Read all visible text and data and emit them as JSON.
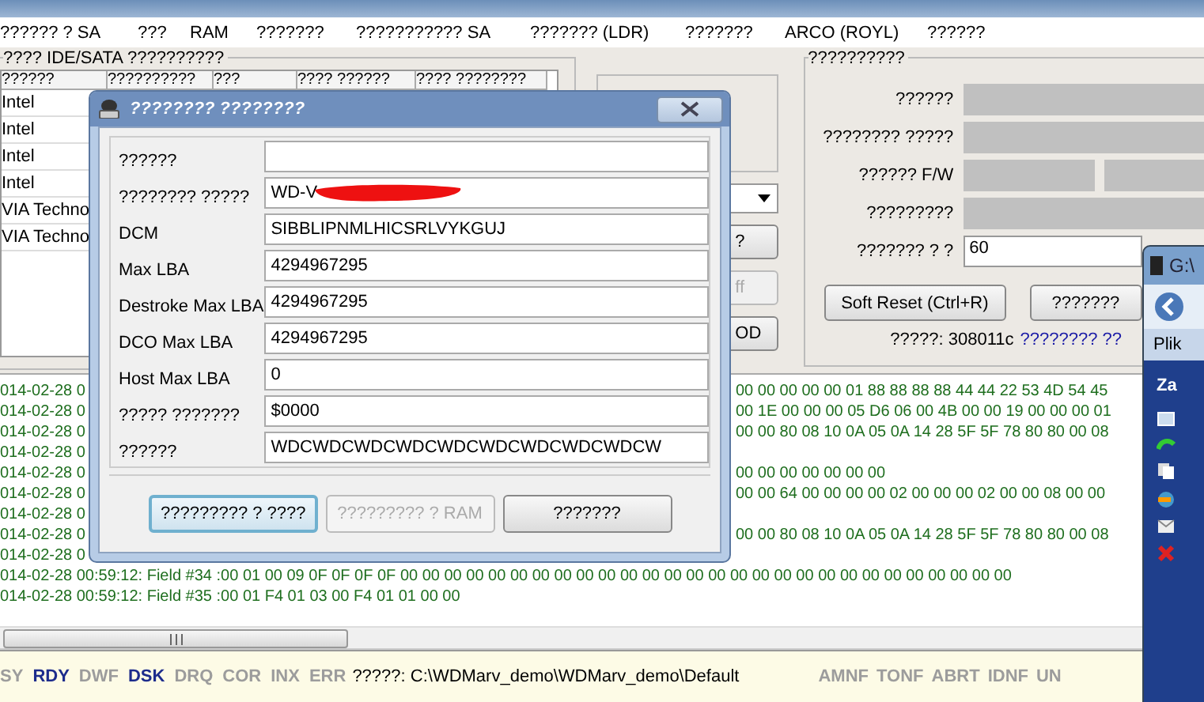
{
  "menu": [
    {
      "label": "?????? ? SA"
    },
    {
      "label": "???"
    },
    {
      "label": "RAM"
    },
    {
      "label": "???????"
    },
    {
      "label": "??????????? SA"
    },
    {
      "label": "??????? (LDR)"
    },
    {
      "label": "???????"
    },
    {
      "label": "ARCO (ROYL)"
    },
    {
      "label": "??????"
    }
  ],
  "drive_group": {
    "title": "???? IDE/SATA ??????????",
    "columns": [
      "??????",
      "??????????",
      "???",
      "???? ??????",
      "???? ????????"
    ],
    "rows": [
      "Intel",
      "Intel",
      "Intel",
      "Intel",
      "VIA Techno",
      "VIA Techno"
    ]
  },
  "middle": {
    "buttons": [
      {
        "label": "?",
        "disabled": false
      },
      {
        "label": "ff",
        "disabled": true
      },
      {
        "label": "OD",
        "disabled": false
      }
    ]
  },
  "info_group": {
    "title": "??????????",
    "rows": [
      {
        "label": "??????",
        "kind": "single"
      },
      {
        "label": "???????? ?????",
        "kind": "single"
      },
      {
        "label": "?????? F/W",
        "kind": "double"
      },
      {
        "label": "?????????",
        "kind": "single"
      },
      {
        "label": "??????? ? ?",
        "kind": "input",
        "value": "60"
      }
    ],
    "buttons": [
      "Soft Reset (Ctrl+R)",
      "???????"
    ],
    "footer": "?????: 308011c",
    "footer_link": "???????? ??"
  },
  "log": [
    {
      "kind": "split",
      "left": "014-02-28 0",
      "right": "00 00 00 00 00 01 88 88 88 88 44 44 22 53 4D 54 45"
    },
    {
      "kind": "split",
      "left": "014-02-28 0",
      "right": "00 1E 00 00 00 05 D6 06 00 4B 00 00 19 00 00 00 01"
    },
    {
      "kind": "split",
      "left": "014-02-28 0",
      "right": "00 00 80 08 10 0A 05 0A 14 28 5F 5F 78 80 80 00 08"
    },
    {
      "kind": "split",
      "left": "014-02-28 0"
    },
    {
      "kind": "split",
      "left": "014-02-28 0",
      "right": " 00 00 00 00 00 00 00"
    },
    {
      "kind": "split",
      "left": "014-02-28 0",
      "right": "00 00 64 00 00 00 00 02 00 00 00 02 00 00 08 00 00"
    },
    {
      "kind": "split",
      "left": "014-02-28 0"
    },
    {
      "kind": "split",
      "left": "014-02-28 0",
      "right": "00 00 80 08 10 0A 05 0A 14 28 5F 5F 78 80 80 00 08"
    },
    {
      "kind": "split",
      "left": "014-02-28 0"
    },
    {
      "kind": "full",
      "text": "014-02-28 00:59:12: Field #34 :00 01 00 09 0F 0F 0F 0F 00 00 00 00 00 00 00 00 00 00 00 00 00 00 00 00 00 00 00 00 00 00 00 00 00 00 00 00"
    },
    {
      "kind": "full",
      "text": "014-02-28 00:59:12: Field #35 :00 01 F4 01 03 00 F4 01 01 00 00"
    }
  ],
  "status_bar": {
    "flags": [
      {
        "label": "SY",
        "on": false
      },
      {
        "label": "RDY",
        "on": true
      },
      {
        "label": "DWF",
        "on": false
      },
      {
        "label": "DSK",
        "on": true
      },
      {
        "label": "DRQ",
        "on": false
      },
      {
        "label": "COR",
        "on": false
      },
      {
        "label": "INX",
        "on": false
      },
      {
        "label": "ERR",
        "on": false
      }
    ],
    "path": "?????: C:\\WDMarv_demo\\WDMarv_demo\\Default",
    "error_flags": [
      {
        "label": "AMNF",
        "on": false
      },
      {
        "label": "TONF",
        "on": false
      },
      {
        "label": "ABRT",
        "on": false
      },
      {
        "label": "IDNF",
        "on": false
      },
      {
        "label": "UN",
        "on": false
      }
    ]
  },
  "dialog": {
    "title": "???????? ????????",
    "fields": [
      {
        "label": "??????"
      },
      {
        "label": "???????? ?????",
        "value": "WD-V",
        "redacted": true
      },
      {
        "label": "DCM",
        "value": "SIBBLIPNMLHICSRLVYKGUJ"
      },
      {
        "label": "Max LBA",
        "value": "4294967295"
      },
      {
        "label": "Destroke Max LBA",
        "value": "4294967295"
      },
      {
        "label": "DCO Max LBA",
        "value": "4294967295"
      },
      {
        "label": "Host Max LBA",
        "value": "0"
      },
      {
        "label": "????? ???????",
        "value": "$0000"
      },
      {
        "label": "??????",
        "value": "WDCWDCWDCWDCWDCWDCWDCWDCWDCW"
      }
    ],
    "buttons": [
      {
        "label": "????????? ? ????",
        "disabled": false,
        "focused": true
      },
      {
        "label": "????????? ? RAM",
        "disabled": true,
        "focused": false
      },
      {
        "label": "???????",
        "disabled": false,
        "focused": false
      }
    ]
  },
  "side_window": {
    "title": "G:\\",
    "menu": "Plik",
    "section": "Za"
  }
}
